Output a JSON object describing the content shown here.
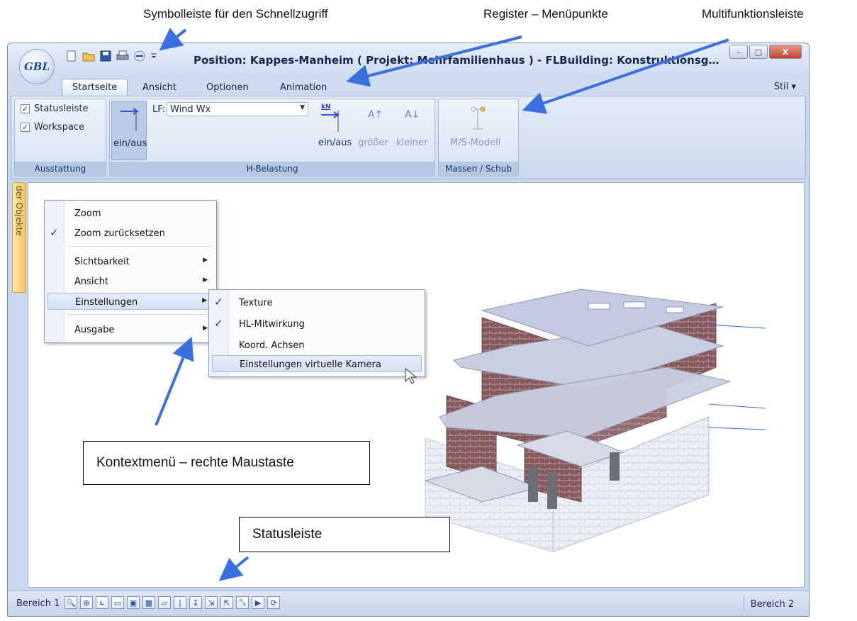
{
  "callouts": {
    "qat": "Symbolleiste für den Schnellzugriff",
    "register": "Register – Menüpunkte",
    "ribbon": "Multifunktionsleiste",
    "context": "Kontextmenü – rechte Maustaste",
    "status": "Statusleiste"
  },
  "window": {
    "title": "Position: Kappes-Manheim ( Projekt: Mehrfamilienhaus ) - FLBuilding: Konstruktionsg…",
    "logo": "GBL",
    "controls": {
      "min": "–",
      "max": "▢",
      "close": "X"
    }
  },
  "qat_icons": [
    "new-icon",
    "open-icon",
    "save-icon",
    "print-icon",
    "view-icon"
  ],
  "tabs": [
    "Startseite",
    "Ansicht",
    "Optionen",
    "Animation"
  ],
  "stil": "Stil ▾",
  "ribbon": {
    "ausstattung": {
      "label": "Ausstattung",
      "checks": [
        {
          "label": "Statusleiste",
          "checked": true
        },
        {
          "label": "Workspace",
          "checked": true
        }
      ]
    },
    "h_belastung": {
      "label": "H-Belastung",
      "toggle1": "ein/aus",
      "lf_label": "LF:",
      "lf_value": "Wind Wx",
      "kn_unit": "kN",
      "toggle2": "ein/aus",
      "bigger": "größer",
      "smaller": "kleiner"
    },
    "massen": {
      "label": "Massen / Schub",
      "model": "M/S-Modell"
    }
  },
  "side_tab": "der Objekte",
  "context_menu": {
    "items": [
      "Zoom",
      "Zoom zurücksetzen",
      "Sichtbarkeit",
      "Ansicht",
      "Einstellungen",
      "Ausgabe"
    ],
    "checked": "Zoom zurücksetzen",
    "highlighted": "Einstellungen"
  },
  "sub_menu": {
    "items": [
      "Texture",
      "HL-Mitwirkung",
      "Koord. Achsen",
      "Einstellungen virtuelle Kamera"
    ],
    "checked": [
      "Texture",
      "HL-Mitwirkung"
    ],
    "highlighted": "Einstellungen virtuelle Kamera"
  },
  "statusbar": {
    "left": "Bereich 1",
    "right": "Bereich 2",
    "tools": [
      "zoom-icon",
      "zoom-fit-icon",
      "axes-icon",
      "frame-icon",
      "frame2-icon",
      "brick-icon",
      "slab-icon",
      "column-icon",
      "load-icon",
      "view-x-icon",
      "view-y-icon",
      "view-z-icon",
      "play-icon",
      "rotate-icon"
    ]
  },
  "colors": {
    "accent_arrow": "#3a6fe0",
    "ribbon_bg": "#d8e3f3",
    "brick": "#8a5a5e",
    "slab": "#c9cfe0"
  }
}
